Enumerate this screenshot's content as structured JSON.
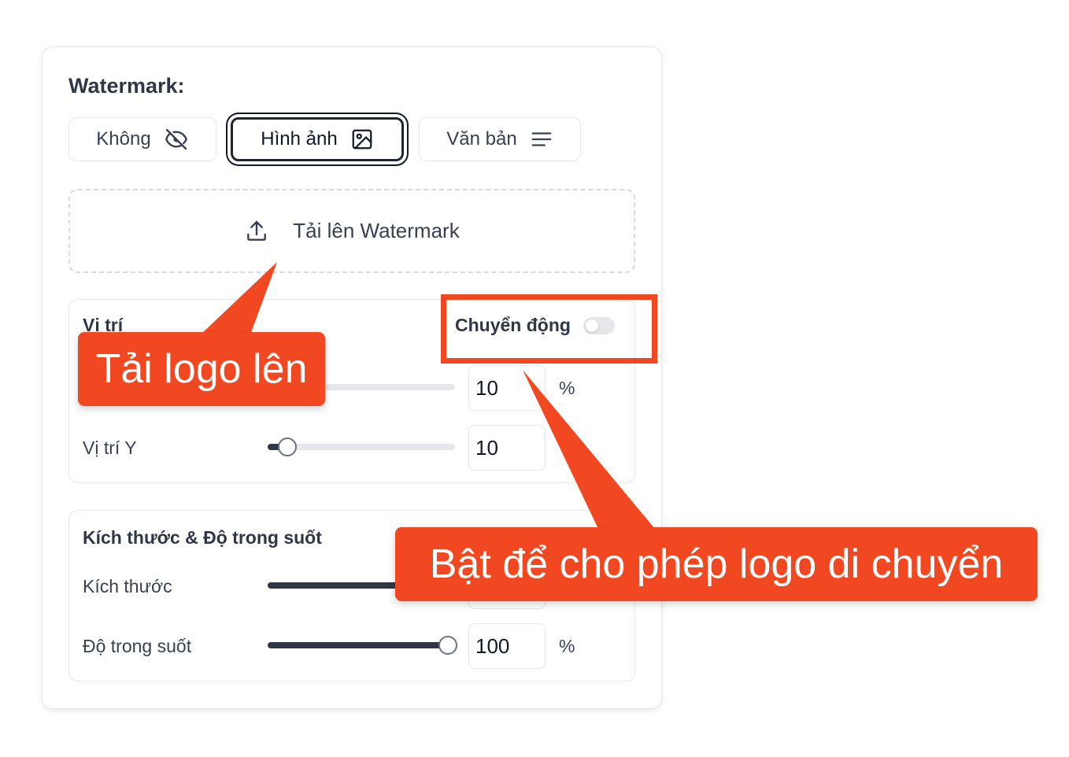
{
  "watermark": {
    "title": "Watermark:",
    "modes": [
      {
        "label": "Không",
        "icon": "eye-off-icon",
        "active": false
      },
      {
        "label": "Hình ảnh",
        "icon": "image-icon",
        "active": true
      },
      {
        "label": "Văn bản",
        "icon": "align-left-icon",
        "active": false
      }
    ],
    "upload_label": "Tải lên Watermark",
    "upload_icon": "upload-icon"
  },
  "position_panel": {
    "title": "Vị trí",
    "motion_label": "Chuyển động",
    "motion_enabled": false,
    "x": {
      "value": "10",
      "unit": "%"
    },
    "y": {
      "label": "Vị trí Y",
      "value": "10",
      "level": 0.1
    }
  },
  "size_panel": {
    "title": "Kích thước & Độ trong suốt",
    "size": {
      "label": "Kích thước"
    },
    "opacity": {
      "label": "Độ trong suốt",
      "value": "100",
      "unit": "%",
      "level": 1.0
    }
  },
  "annotations": {
    "upload_callout": "Tải logo lên",
    "motion_callout": "Bật để cho phép logo di chuyển",
    "accent_color": "#f24822"
  }
}
